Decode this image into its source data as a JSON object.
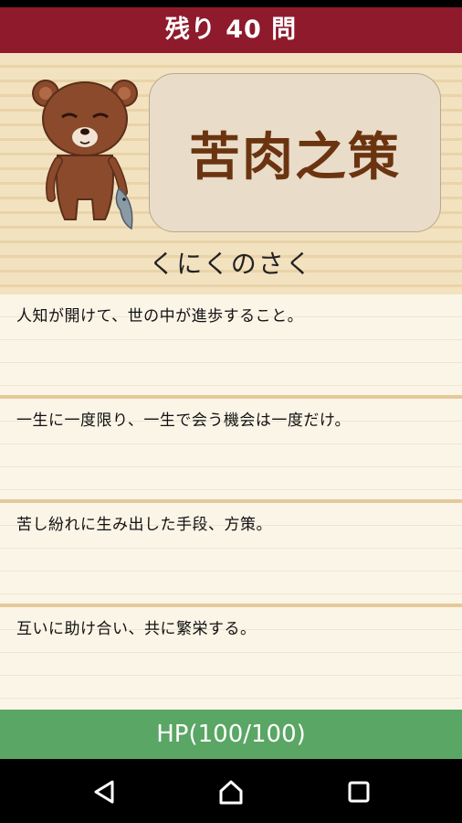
{
  "header": {
    "remaining": "残り 40 問"
  },
  "question": {
    "kanji": "苦肉之策",
    "reading": "くにくのさく"
  },
  "choices": [
    {
      "text": "人知が開けて、世の中が進歩すること。"
    },
    {
      "text": "一生に一度限り、一生で会う機会は一度だけ。"
    },
    {
      "text": "苦し紛れに生み出した手段、方策。"
    },
    {
      "text": "互いに助け合い、共に繁栄する。"
    }
  ],
  "hp": {
    "label": "HP(100/100)"
  },
  "colors": {
    "header": "#8e1a2c",
    "hp_bar": "#5aa664",
    "kanji": "#6b3410"
  },
  "icons": {
    "mascot": "bear-mascot-icon",
    "nav_back": "back-triangle-icon",
    "nav_home": "home-icon",
    "nav_recents": "recents-square-icon"
  }
}
